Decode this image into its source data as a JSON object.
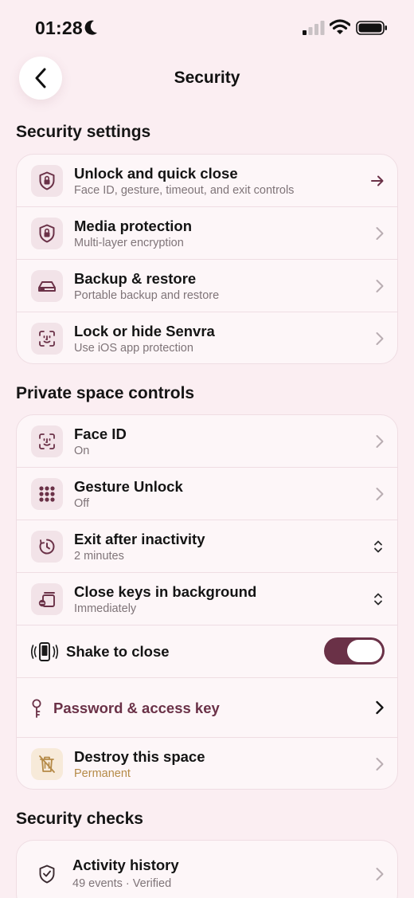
{
  "status": {
    "time": "01:28"
  },
  "nav": {
    "title": "Security"
  },
  "sections": {
    "security_settings": {
      "title": "Security settings",
      "items": [
        {
          "title": "Unlock and quick close",
          "subtitle": "Face ID, gesture, timeout, and exit controls"
        },
        {
          "title": "Media protection",
          "subtitle": "Multi-layer encryption"
        },
        {
          "title": "Backup & restore",
          "subtitle": "Portable backup and restore"
        },
        {
          "title": "Lock or hide Senvra",
          "subtitle": "Use iOS app protection"
        }
      ]
    },
    "private_space": {
      "title": "Private space controls",
      "items": [
        {
          "title": "Face ID",
          "subtitle": "On"
        },
        {
          "title": "Gesture Unlock",
          "subtitle": "Off"
        },
        {
          "title": "Exit after inactivity",
          "subtitle": "2 minutes"
        },
        {
          "title": "Close keys in background",
          "subtitle": "Immediately"
        },
        {
          "title": "Shake to close",
          "enabled": true
        },
        {
          "title": "Password & access key"
        },
        {
          "title": "Destroy this space",
          "subtitle": "Permanent"
        }
      ]
    },
    "security_checks": {
      "title": "Security checks",
      "items": [
        {
          "title": "Activity history",
          "subtitle": "49 events · Verified"
        }
      ]
    }
  },
  "colors": {
    "accent": "#6a3147",
    "background": "#fbeef2",
    "warning": "#b58a47"
  },
  "icons": {
    "status": [
      "moon-icon",
      "cellular-signal-icon",
      "wifi-icon",
      "battery-icon"
    ],
    "rows": [
      "shield-lock-icon",
      "shield-lock-icon",
      "drive-icon",
      "face-scan-icon",
      "face-scan-icon",
      "keypad-dots-icon",
      "timer-icon",
      "background-windows-icon",
      "shake-phone-icon",
      "key-icon",
      "trash-warning-icon",
      "shield-check-icon"
    ]
  }
}
